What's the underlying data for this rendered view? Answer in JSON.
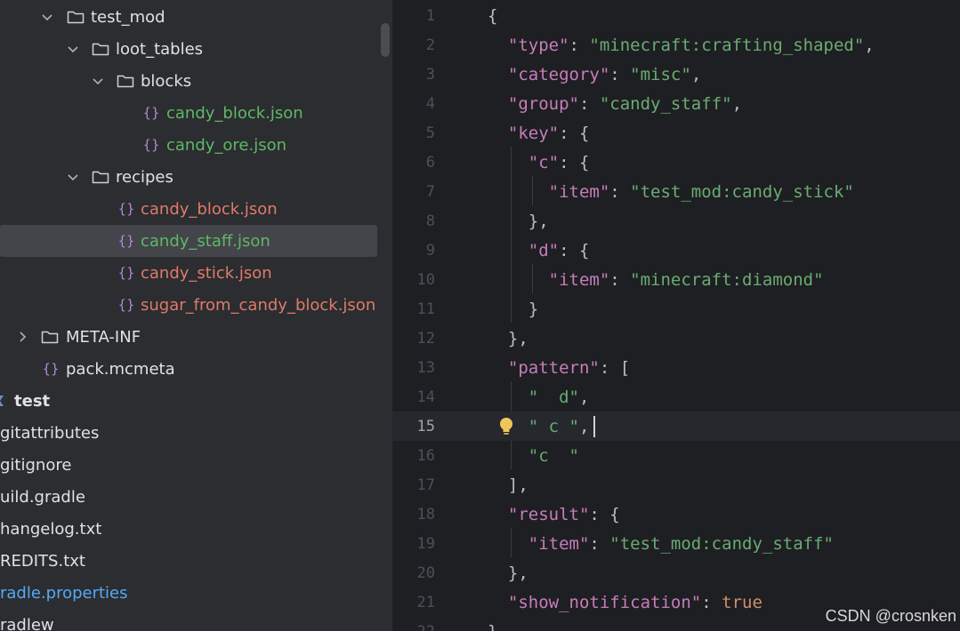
{
  "colors": {
    "tree_bg": "#2b2d30",
    "editor_bg": "#1e1f22",
    "selected_row": "#43454a",
    "json_key": "#c77dbb",
    "json_string": "#6aab73",
    "json_keyword": "#cf8e6d",
    "vcs_added": "#5fb865",
    "vcs_unversioned": "#e07a6b",
    "vcs_modified": "#56a8f5"
  },
  "tree": {
    "items": [
      {
        "label": "test_mod",
        "type": "folder",
        "expanded": true,
        "status": "normal"
      },
      {
        "label": "loot_tables",
        "type": "folder",
        "expanded": true,
        "status": "normal"
      },
      {
        "label": "blocks",
        "type": "folder",
        "expanded": true,
        "status": "normal"
      },
      {
        "label": "candy_block.json",
        "type": "json-file",
        "status": "added"
      },
      {
        "label": "candy_ore.json",
        "type": "json-file",
        "status": "added"
      },
      {
        "label": "recipes",
        "type": "folder",
        "expanded": true,
        "status": "normal"
      },
      {
        "label": "candy_block.json",
        "type": "json-file",
        "status": "unversioned"
      },
      {
        "label": "candy_staff.json",
        "type": "json-file",
        "status": "added",
        "selected": true
      },
      {
        "label": "candy_stick.json",
        "type": "json-file",
        "status": "unversioned"
      },
      {
        "label": "sugar_from_candy_block.json",
        "type": "json-file",
        "status": "unversioned"
      },
      {
        "label": "META-INF",
        "type": "folder",
        "expanded": false,
        "status": "normal"
      },
      {
        "label": "pack.mcmeta",
        "type": "json-file",
        "status": "normal"
      },
      {
        "label": "test",
        "type": "module",
        "status": "bold"
      },
      {
        "label": "gitattributes",
        "type": "file",
        "status": "normal"
      },
      {
        "label": "gitignore",
        "type": "file",
        "status": "normal"
      },
      {
        "label": "uild.gradle",
        "type": "file",
        "status": "normal"
      },
      {
        "label": "hangelog.txt",
        "type": "file",
        "status": "normal"
      },
      {
        "label": "REDITS.txt",
        "type": "file",
        "status": "normal"
      },
      {
        "label": "radle.properties",
        "type": "file",
        "status": "modified"
      },
      {
        "label": "radlew",
        "type": "file",
        "status": "normal"
      }
    ]
  },
  "editor": {
    "current_line": 15,
    "lines": [
      {
        "num": "1",
        "tokens": [
          {
            "t": "p",
            "v": "{"
          }
        ]
      },
      {
        "num": "2",
        "tokens": [
          {
            "t": "p",
            "v": "  "
          },
          {
            "t": "key",
            "v": "\"type\""
          },
          {
            "t": "p",
            "v": ": "
          },
          {
            "t": "str",
            "v": "\"minecraft:crafting_shaped\""
          },
          {
            "t": "p",
            "v": ","
          }
        ]
      },
      {
        "num": "3",
        "tokens": [
          {
            "t": "p",
            "v": "  "
          },
          {
            "t": "key",
            "v": "\"category\""
          },
          {
            "t": "p",
            "v": ": "
          },
          {
            "t": "str",
            "v": "\"misc\""
          },
          {
            "t": "p",
            "v": ","
          }
        ]
      },
      {
        "num": "4",
        "tokens": [
          {
            "t": "p",
            "v": "  "
          },
          {
            "t": "key",
            "v": "\"group\""
          },
          {
            "t": "p",
            "v": ": "
          },
          {
            "t": "str",
            "v": "\"candy_staff\""
          },
          {
            "t": "p",
            "v": ","
          }
        ]
      },
      {
        "num": "5",
        "tokens": [
          {
            "t": "p",
            "v": "  "
          },
          {
            "t": "key",
            "v": "\"key\""
          },
          {
            "t": "p",
            "v": ": {"
          }
        ]
      },
      {
        "num": "6",
        "tokens": [
          {
            "t": "p",
            "v": "    "
          },
          {
            "t": "key",
            "v": "\"c\""
          },
          {
            "t": "p",
            "v": ": {"
          }
        ]
      },
      {
        "num": "7",
        "tokens": [
          {
            "t": "p",
            "v": "      "
          },
          {
            "t": "key",
            "v": "\"item\""
          },
          {
            "t": "p",
            "v": ": "
          },
          {
            "t": "str",
            "v": "\"test_mod:candy_stick\""
          }
        ]
      },
      {
        "num": "8",
        "tokens": [
          {
            "t": "p",
            "v": "    },"
          }
        ]
      },
      {
        "num": "9",
        "tokens": [
          {
            "t": "p",
            "v": "    "
          },
          {
            "t": "key",
            "v": "\"d\""
          },
          {
            "t": "p",
            "v": ": {"
          }
        ]
      },
      {
        "num": "10",
        "tokens": [
          {
            "t": "p",
            "v": "      "
          },
          {
            "t": "key",
            "v": "\"item\""
          },
          {
            "t": "p",
            "v": ": "
          },
          {
            "t": "str",
            "v": "\"minecraft:diamond\""
          }
        ]
      },
      {
        "num": "11",
        "tokens": [
          {
            "t": "p",
            "v": "    }"
          }
        ]
      },
      {
        "num": "12",
        "tokens": [
          {
            "t": "p",
            "v": "  },"
          }
        ]
      },
      {
        "num": "13",
        "tokens": [
          {
            "t": "p",
            "v": "  "
          },
          {
            "t": "key",
            "v": "\"pattern\""
          },
          {
            "t": "p",
            "v": ": ["
          }
        ]
      },
      {
        "num": "14",
        "tokens": [
          {
            "t": "p",
            "v": "    "
          },
          {
            "t": "str",
            "v": "\"  d\""
          },
          {
            "t": "p",
            "v": ","
          }
        ]
      },
      {
        "num": "15",
        "tokens": [
          {
            "t": "p",
            "v": "    "
          },
          {
            "t": "str",
            "v": "\" c \""
          },
          {
            "t": "p",
            "v": ","
          }
        ]
      },
      {
        "num": "16",
        "tokens": [
          {
            "t": "p",
            "v": "    "
          },
          {
            "t": "str",
            "v": "\"c  \""
          }
        ]
      },
      {
        "num": "17",
        "tokens": [
          {
            "t": "p",
            "v": "  ],"
          }
        ]
      },
      {
        "num": "18",
        "tokens": [
          {
            "t": "p",
            "v": "  "
          },
          {
            "t": "key",
            "v": "\"result\""
          },
          {
            "t": "p",
            "v": ": {"
          }
        ]
      },
      {
        "num": "19",
        "tokens": [
          {
            "t": "p",
            "v": "    "
          },
          {
            "t": "key",
            "v": "\"item\""
          },
          {
            "t": "p",
            "v": ": "
          },
          {
            "t": "str",
            "v": "\"test_mod:candy_staff\""
          }
        ]
      },
      {
        "num": "20",
        "tokens": [
          {
            "t": "p",
            "v": "  },"
          }
        ]
      },
      {
        "num": "21",
        "tokens": [
          {
            "t": "p",
            "v": "  "
          },
          {
            "t": "key",
            "v": "\"show_notification\""
          },
          {
            "t": "p",
            "v": ": "
          },
          {
            "t": "kw",
            "v": "true"
          }
        ]
      },
      {
        "num": "22",
        "tokens": [
          {
            "t": "p",
            "v": "}"
          }
        ]
      }
    ]
  },
  "icons": {
    "intention_bulb": "lightbulb-icon"
  },
  "watermark": "CSDN @crosnken"
}
